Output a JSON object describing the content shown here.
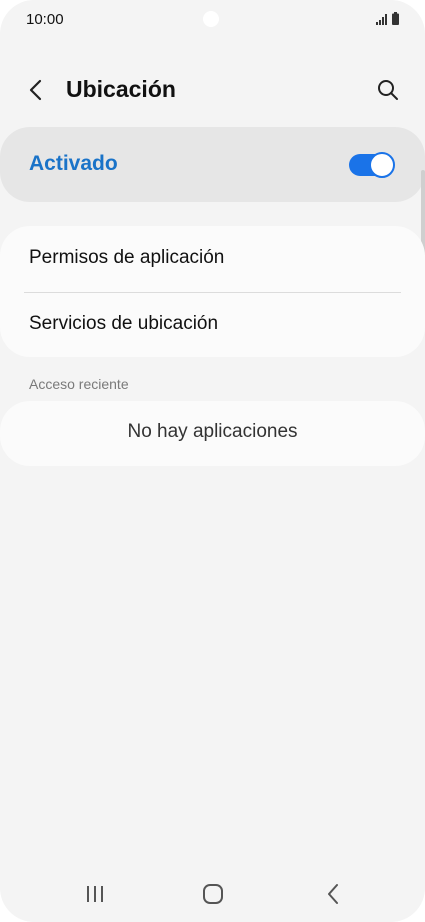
{
  "status_bar": {
    "time": "10:00",
    "icons": [
      "signal-icon",
      "battery-icon"
    ]
  },
  "header": {
    "title": "Ubicación",
    "back_icon": "back-arrow-icon",
    "search_icon": "search-icon"
  },
  "master_toggle": {
    "label": "Activado",
    "state": "on",
    "accent_color": "#1a73e8"
  },
  "menu": {
    "items": [
      {
        "label": "Permisos de aplicación"
      },
      {
        "label": "Servicios de ubicación"
      }
    ]
  },
  "recent_access": {
    "section_label": "Acceso reciente",
    "empty_text": "No hay aplicaciones"
  },
  "nav_bar": {
    "buttons": [
      "recents-icon",
      "home-icon",
      "back-icon"
    ]
  }
}
